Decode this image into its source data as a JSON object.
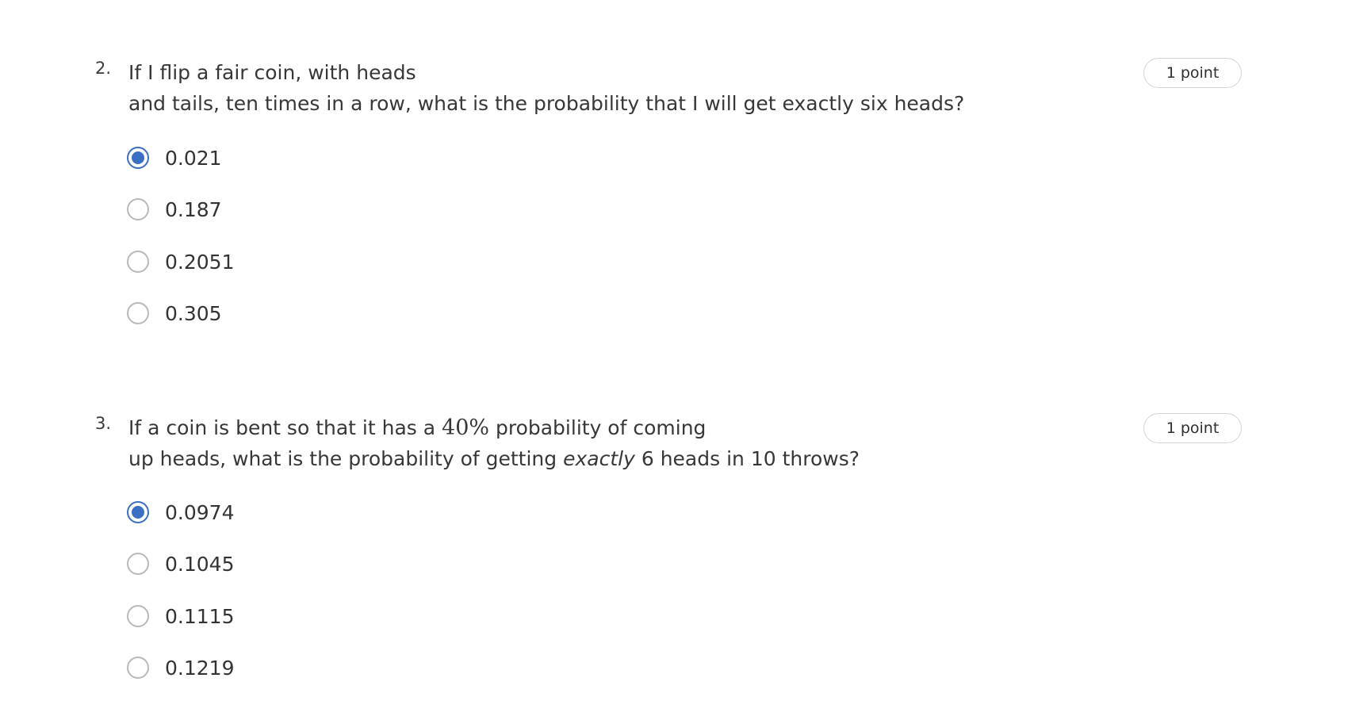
{
  "accent_color": "#3b6fc4",
  "questions": [
    {
      "number": "2.",
      "line1": "If I flip a fair coin, with heads",
      "line2": "and tails, ten times in a row, what is the probability that I will get exactly six heads?",
      "points": "1 point",
      "selected_index": 0,
      "options": [
        "0.021",
        "0.187",
        "0.2051",
        "0.305"
      ]
    },
    {
      "number": "3.",
      "line1_pre": "If a coin is bent so that it has a ",
      "line1_math": "40%",
      "line1_post": " probability of coming",
      "line2_pre": "up heads, what is the probability of getting ",
      "line2_em": "exactly",
      "line2_post": " 6 heads in 10 throws?",
      "points": "1 point",
      "selected_index": 0,
      "options": [
        "0.0974",
        "0.1045",
        "0.1115",
        "0.1219"
      ]
    }
  ]
}
